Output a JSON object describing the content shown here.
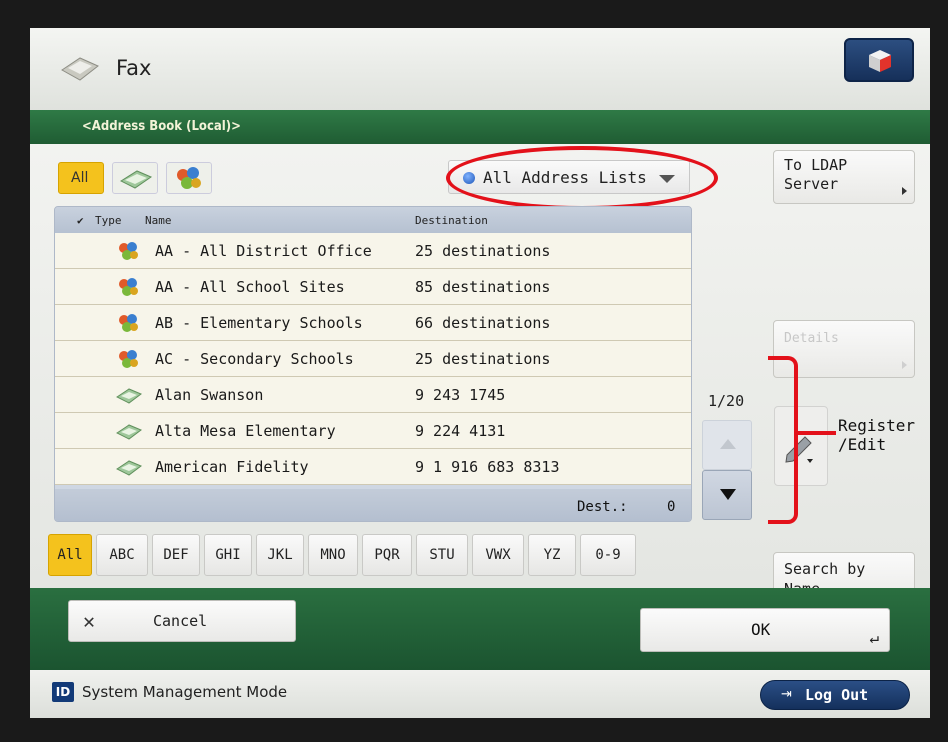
{
  "header": {
    "title": "Fax",
    "menu_icon": "settings-cube-icon"
  },
  "section": {
    "title": "<Address Book (Local)>"
  },
  "type_filters": [
    {
      "label": "All",
      "selected": true
    },
    {
      "icon": "person-book-icon"
    },
    {
      "icon": "group-list-icon"
    }
  ],
  "address_list": {
    "label": "All Address Lists"
  },
  "ldap_button": {
    "line1": "To LDAP",
    "line2": "Server"
  },
  "details_button": {
    "label": "Details"
  },
  "search_button": {
    "line1": "Search by",
    "line2": "Name"
  },
  "register_button": {
    "line1": "Register",
    "line2": "/Edit"
  },
  "pager": {
    "page": "1/20"
  },
  "list": {
    "headers": {
      "check": "✔",
      "type": "Type",
      "name": "Name",
      "destination": "Destination"
    },
    "rows": [
      {
        "type": "group",
        "name": "AA - All District Office",
        "destination": "25 destinations"
      },
      {
        "type": "group",
        "name": "AA - All School Sites",
        "destination": "85 destinations"
      },
      {
        "type": "group",
        "name": "AB - Elementary Schools",
        "destination": "66 destinations"
      },
      {
        "type": "group",
        "name": "AC - Secondary Schools",
        "destination": "25 destinations"
      },
      {
        "type": "fax",
        "name": "Alan Swanson",
        "destination": "9 243 1745"
      },
      {
        "type": "fax",
        "name": "Alta Mesa Elementary",
        "destination": "9 224 4131"
      },
      {
        "type": "fax",
        "name": "American Fidelity",
        "destination": "9 1 916 683 8313"
      }
    ],
    "footer": {
      "dest_label": "Dest.:",
      "dest_count": "0"
    }
  },
  "alpha_tabs": [
    "All",
    "ABC",
    "DEF",
    "GHI",
    "JKL",
    "MNO",
    "PQR",
    "STU",
    "VWX",
    "YZ",
    "0-9"
  ],
  "footer": {
    "cancel_label": "Cancel",
    "ok_label": "OK"
  },
  "status": {
    "id_badge": "ID",
    "mode": "System Management Mode",
    "logout_label": "Log Out"
  },
  "colors": {
    "accent_green": "#1f5c33",
    "selected_yellow": "#f4c21d",
    "annotation_red": "#e3111a"
  }
}
